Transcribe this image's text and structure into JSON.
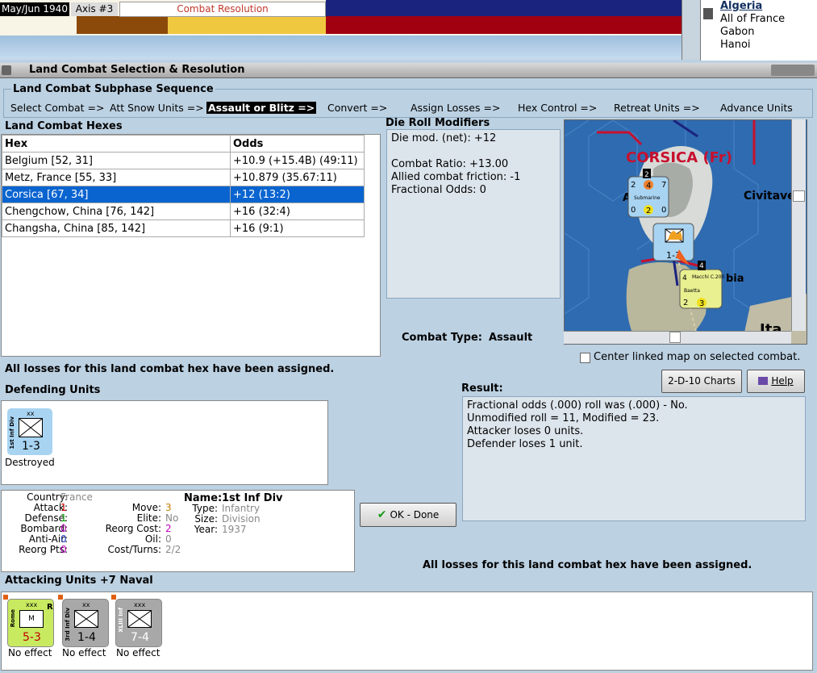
{
  "top": {
    "date": "May/Jun 1940",
    "axis_tab": "Axis #3",
    "phase": "Combat Resolution"
  },
  "bands": [
    "#f8f4e6",
    "#8b4a0a",
    "#f0c840",
    "#a00010",
    "#1a237e"
  ],
  "right_list": [
    "Algeria",
    "All of France",
    "Gabon",
    "Hanoi"
  ],
  "window_title": "Land Combat Selection & Resolution",
  "subphase": {
    "title": "Land Combat Subphase Sequence",
    "steps": [
      "Select Combat =>",
      "Att Snow Units =>",
      "Assault or Blitz =>",
      "Convert =>",
      "Assign Losses =>",
      "Hex Control =>",
      "Retreat Units =>",
      "Advance Units"
    ],
    "active_index": 2
  },
  "hexes": {
    "title": "Land Combat Hexes",
    "headers": [
      "Hex",
      "Odds"
    ],
    "rows": [
      [
        "Belgium [52, 31]",
        "+10.9 (+15.4B) (49:11)"
      ],
      [
        "Metz, France [55, 33]",
        "+10.879 (35.67:11)"
      ],
      [
        "Corsica [67, 34]",
        "+12 (13:2)"
      ],
      [
        "Chengchow, China [76, 142]",
        "+16 (32:4)"
      ],
      [
        "Changsha, China [85, 142]",
        "+16 (9:1)"
      ]
    ],
    "selected": 2
  },
  "die_roll": {
    "title": "Die Roll Modifiers",
    "lines": [
      "Die mod. (net): +12",
      "",
      "Combat Ratio: +13.00",
      "Allied combat friction: -1",
      "Fractional Odds: 0"
    ]
  },
  "map": {
    "region": "CORSICA (Fr)",
    "town": "Civitave",
    "bia": "bia",
    "ita": "Ita",
    "a_left": "A"
  },
  "combat_type": {
    "label": "Combat Type:",
    "value": "Assault"
  },
  "center_linked": "Center linked map on selected combat.",
  "buttons": {
    "charts": "2-D-10 Charts",
    "help": "Help",
    "ok": "OK - Done"
  },
  "losses_msg": "All losses for this land combat hex have been assigned.",
  "result": {
    "title": "Result:",
    "lines": [
      "Fractional odds (.000) roll was (.000)  - No.",
      "Unmodified roll = 11, Modified = 23.",
      "Attacker loses 0 units.",
      "Defender loses 1 unit."
    ]
  },
  "defending": {
    "title": "Defending Units",
    "units": [
      {
        "side": "1st Inf Div",
        "size": "xx",
        "value": "1-3",
        "status": "Destroyed"
      }
    ]
  },
  "details": {
    "country_l": "Country:",
    "country": "France",
    "attack_l": "Attack:",
    "attack": "1",
    "defense_l": "Defense:",
    "defense": "1",
    "bombard_l": "Bombard:",
    "bombard": "0",
    "antiair_l": "Anti-Air:",
    "antiair": "0",
    "reorgpts_l": "Reorg Pts:",
    "reorgpts": "0",
    "move_l": "Move:",
    "move": "3",
    "elite_l": "Elite:",
    "elite": "No",
    "reorgcost_l": "Reorg Cost:",
    "reorgcost": "2",
    "oil_l": "Oil:",
    "oil": "0",
    "costturns_l": "Cost/Turns:",
    "costturns": "2/2",
    "name_l": "Name:",
    "name": "1st Inf Div",
    "type_l": "Type:",
    "type": "Infantry",
    "size_l": "Size:",
    "size": "Division",
    "year_l": "Year:",
    "year": "1937"
  },
  "attacking": {
    "title": "Attacking Units +7 Naval",
    "units": [
      {
        "side": "Rome",
        "size": "xxx",
        "value": "5-3",
        "status": "No effect",
        "badge": "R",
        "inner": "M"
      },
      {
        "side": "3rd Inf Div",
        "size": "xx",
        "value": "1-4",
        "status": "No effect"
      },
      {
        "side": "XLIII Inf",
        "size": "xxx",
        "value": "7-4",
        "status": "No effect"
      }
    ]
  },
  "counters": {
    "sub_top": "2",
    "sub_mid_l": "2",
    "sub_mid_c": "4",
    "sub_mid_r": "7",
    "sub_name": "Submarine",
    "sub_bot_l": "0",
    "sub_bot_c": "2",
    "sub_bot_r": "0",
    "inf_value": "1-3",
    "inf_side": "1st Inf Div",
    "air_top": "4",
    "air_name": "Macchi C.200",
    "air_left": "4",
    "air_base": "Baetta",
    "air_bot_l": "2",
    "air_bot_c": "3"
  },
  "colors": {
    "selection": "#0a64d0",
    "bg": "#bcd1e2",
    "sea": "#2f6bb0",
    "unit_blue": "#a8d4f2",
    "unit_green": "#c8ea60",
    "unit_gray": "#a8a8a8"
  }
}
